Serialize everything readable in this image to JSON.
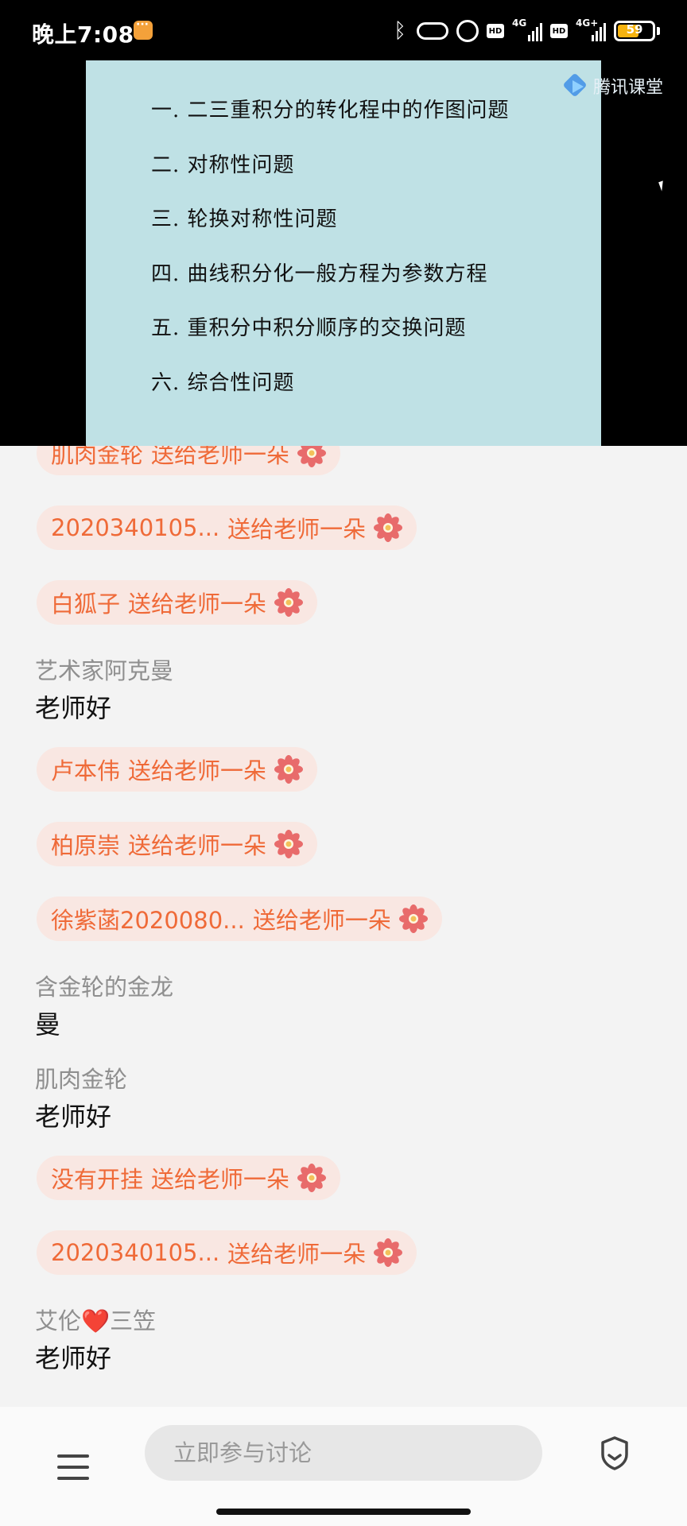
{
  "status_bar": {
    "time": "晚上7:08",
    "hd_label": "HD",
    "net1": "4G",
    "net2": "4G+",
    "battery_level": "59"
  },
  "video": {
    "brand_name": "腾讯课堂",
    "slide_items": [
      "一. 二三重积分的转化程中的作图问题",
      "二. 对称性问题",
      "三. 轮换对称性问题",
      "四. 曲线积分化一般方程为参数方程",
      "五. 重积分中积分顺序的交换问题",
      "六. 综合性问题"
    ]
  },
  "chat": {
    "gift_suffix": "送给老师一朵",
    "messages": [
      {
        "type": "gift",
        "user": "肌肉金轮"
      },
      {
        "type": "gift",
        "user": "2020340105..."
      },
      {
        "type": "gift",
        "user": "白狐子"
      },
      {
        "type": "text",
        "user": "艺术家阿克曼",
        "text": "老师好"
      },
      {
        "type": "gift",
        "user": "卢本伟"
      },
      {
        "type": "gift",
        "user": "柏原崇"
      },
      {
        "type": "gift",
        "user": "徐紫菡2020080..."
      },
      {
        "type": "text",
        "user": "含金轮的金龙",
        "text": "曼"
      },
      {
        "type": "text",
        "user": "肌肉金轮",
        "text": "老师好"
      },
      {
        "type": "gift",
        "user": "没有开挂"
      },
      {
        "type": "gift",
        "user": "2020340105..."
      },
      {
        "type": "text",
        "user": "艾伦❤️三笠",
        "text": "老师好"
      }
    ]
  },
  "bottom_bar": {
    "input_placeholder": "立即参与讨论"
  },
  "colors": {
    "gift_text": "#ef6a38",
    "gift_bg": "#f9e7e2",
    "slide_bg": "#bfe1e5",
    "flower": "#e86b6b"
  }
}
